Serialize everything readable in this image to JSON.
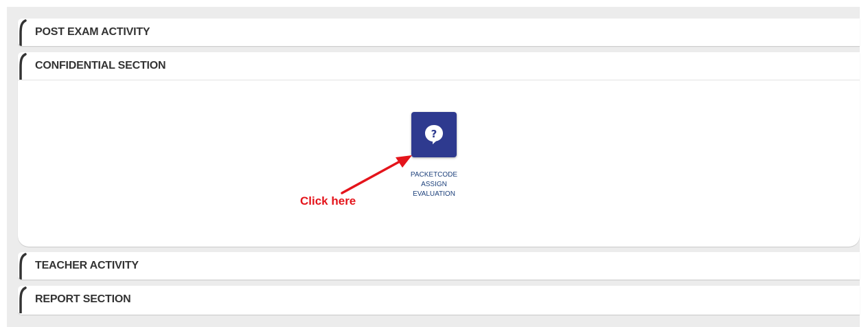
{
  "sections": [
    {
      "title": "POST EXAM ACTIVITY"
    },
    {
      "title": "CONFIDENTIAL SECTION"
    },
    {
      "title": "TEACHER ACTIVITY"
    },
    {
      "title": "REPORT SECTION"
    }
  ],
  "confidential": {
    "tile": {
      "icon": "question-bubble-icon",
      "label_lines": [
        "PACKETCODE",
        "ASSIGN",
        "EVALUATION"
      ],
      "color": "#2e3a8f"
    },
    "annotation": {
      "text": "Click here",
      "color": "#e4141b"
    }
  }
}
